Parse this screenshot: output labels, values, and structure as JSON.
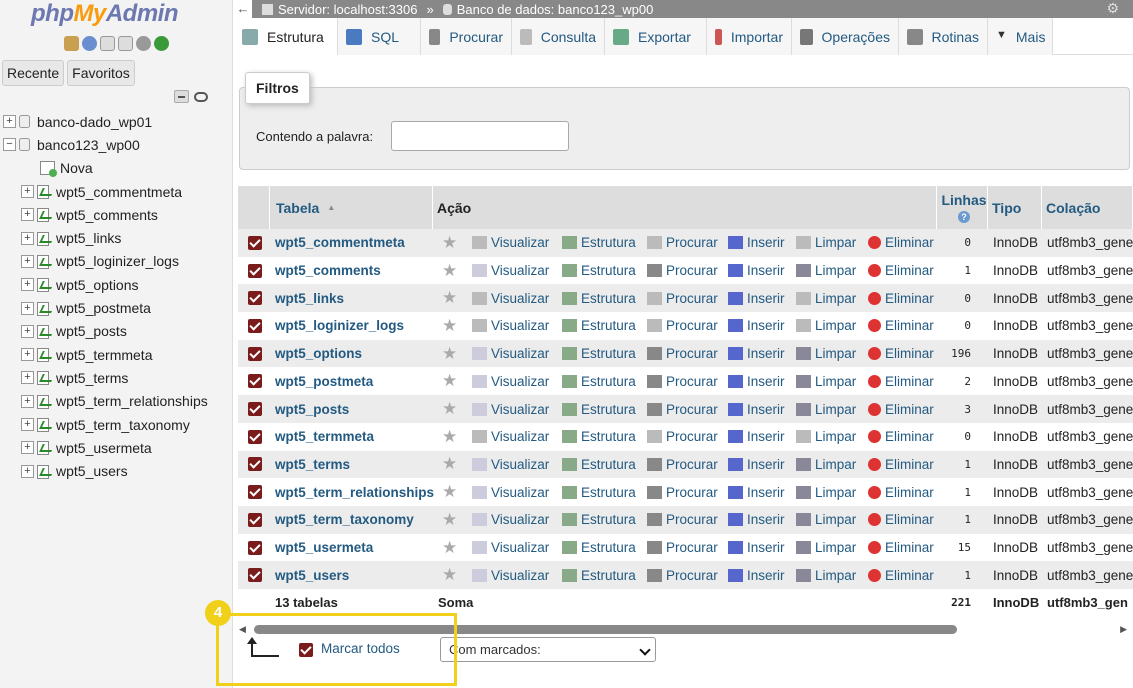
{
  "sidebar": {
    "logo": {
      "php": "php",
      "my": "My",
      "admin": "Admin"
    },
    "tabs": [
      "Recente",
      "Favoritos"
    ],
    "tree": [
      {
        "label": "banco-dado_wp01",
        "type": "db",
        "expanded": false
      },
      {
        "label": "banco123_wp00",
        "type": "db",
        "expanded": true
      },
      {
        "label": "Nova",
        "type": "new"
      },
      {
        "label": "wpt5_commentmeta",
        "type": "table"
      },
      {
        "label": "wpt5_comments",
        "type": "table"
      },
      {
        "label": "wpt5_links",
        "type": "table"
      },
      {
        "label": "wpt5_loginizer_logs",
        "type": "table"
      },
      {
        "label": "wpt5_options",
        "type": "table"
      },
      {
        "label": "wpt5_postmeta",
        "type": "table"
      },
      {
        "label": "wpt5_posts",
        "type": "table"
      },
      {
        "label": "wpt5_termmeta",
        "type": "table"
      },
      {
        "label": "wpt5_terms",
        "type": "table"
      },
      {
        "label": "wpt5_term_relationships",
        "type": "table"
      },
      {
        "label": "wpt5_term_taxonomy",
        "type": "table"
      },
      {
        "label": "wpt5_usermeta",
        "type": "table"
      },
      {
        "label": "wpt5_users",
        "type": "table"
      }
    ]
  },
  "breadcrumb": {
    "server": "Servidor: localhost:3306",
    "sep": "»",
    "database": "Banco de dados: banco123_wp00"
  },
  "tabs": [
    "Estrutura",
    "SQL",
    "Procurar",
    "Consulta",
    "Exportar",
    "Importar",
    "Operações",
    "Rotinas",
    "Mais"
  ],
  "filters": {
    "legend": "Filtros",
    "label": "Contendo a palavra:",
    "value": ""
  },
  "table": {
    "headers": {
      "table": "Tabela",
      "sort": "▲",
      "action": "Ação",
      "rows": "Linhas",
      "type": "Tipo",
      "collation": "Colação"
    },
    "actions": [
      "Visualizar",
      "Estrutura",
      "Procurar",
      "Inserir",
      "Limpar",
      "Eliminar"
    ],
    "rows": [
      {
        "name": "wpt5_commentmeta",
        "rows": "0",
        "type": "InnoDB",
        "collation": "utf8mb3_gene",
        "empty": true
      },
      {
        "name": "wpt5_comments",
        "rows": "1",
        "type": "InnoDB",
        "collation": "utf8mb3_gene",
        "empty": false
      },
      {
        "name": "wpt5_links",
        "rows": "0",
        "type": "InnoDB",
        "collation": "utf8mb3_gene",
        "empty": true
      },
      {
        "name": "wpt5_loginizer_logs",
        "rows": "0",
        "type": "InnoDB",
        "collation": "utf8mb3_gene",
        "empty": true
      },
      {
        "name": "wpt5_options",
        "rows": "196",
        "type": "InnoDB",
        "collation": "utf8mb3_gene",
        "empty": false
      },
      {
        "name": "wpt5_postmeta",
        "rows": "2",
        "type": "InnoDB",
        "collation": "utf8mb3_gene",
        "empty": false
      },
      {
        "name": "wpt5_posts",
        "rows": "3",
        "type": "InnoDB",
        "collation": "utf8mb3_gene",
        "empty": false
      },
      {
        "name": "wpt5_termmeta",
        "rows": "0",
        "type": "InnoDB",
        "collation": "utf8mb3_gene",
        "empty": true
      },
      {
        "name": "wpt5_terms",
        "rows": "1",
        "type": "InnoDB",
        "collation": "utf8mb3_gene",
        "empty": false
      },
      {
        "name": "wpt5_term_relationships",
        "rows": "1",
        "type": "InnoDB",
        "collation": "utf8mb3_gene",
        "empty": false
      },
      {
        "name": "wpt5_term_taxonomy",
        "rows": "1",
        "type": "InnoDB",
        "collation": "utf8mb3_gene",
        "empty": false
      },
      {
        "name": "wpt5_usermeta",
        "rows": "15",
        "type": "InnoDB",
        "collation": "utf8mb3_gene",
        "empty": false
      },
      {
        "name": "wpt5_users",
        "rows": "1",
        "type": "InnoDB",
        "collation": "utf8mb3_gene",
        "empty": false
      }
    ],
    "footer": {
      "count": "13 tabelas",
      "action": "Soma",
      "rows": "221",
      "type": "InnoDB",
      "collation": "utf8mb3_gen"
    }
  },
  "bulk": {
    "check_all": "Marcar todos",
    "with_selected": "Com marcados:"
  },
  "annotation": {
    "badge": "4"
  },
  "colors": {
    "accent": "#235a81",
    "checkbox": "#7b1c1c",
    "highlight": "#f0d018"
  }
}
